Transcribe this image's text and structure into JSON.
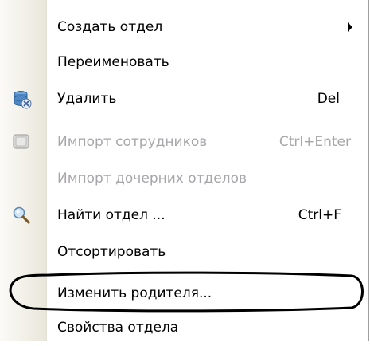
{
  "menu": {
    "items": [
      {
        "label": "Создать отдел",
        "shortcut": "",
        "has_submenu": true,
        "disabled": false,
        "icon": ""
      },
      {
        "label": "Переименовать",
        "shortcut": "",
        "has_submenu": false,
        "disabled": false,
        "icon": ""
      },
      {
        "label": "Удалить",
        "shortcut": "Del",
        "has_submenu": false,
        "disabled": false,
        "icon": "delete-icon",
        "underline_char": "У"
      },
      {
        "label": "Импорт сотрудников",
        "shortcut": "Ctrl+Enter",
        "has_submenu": false,
        "disabled": true,
        "icon": "import-icon"
      },
      {
        "label": "Импорт дочерних отделов",
        "shortcut": "",
        "has_submenu": false,
        "disabled": true,
        "icon": ""
      },
      {
        "label": "Найти отдел ...",
        "shortcut": "Ctrl+F",
        "has_submenu": false,
        "disabled": false,
        "icon": "search-icon"
      },
      {
        "label": "Отсортировать",
        "shortcut": "",
        "has_submenu": false,
        "disabled": false,
        "icon": ""
      },
      {
        "label": "Изменить родителя...",
        "shortcut": "",
        "has_submenu": false,
        "disabled": false,
        "icon": "",
        "highlighted": true
      },
      {
        "label": "Свойства отдела",
        "shortcut": "",
        "has_submenu": false,
        "disabled": false,
        "icon": ""
      }
    ]
  },
  "colors": {
    "text": "#000000",
    "disabled_text": "#a7a6aa",
    "highlight_outline": "#000000"
  }
}
